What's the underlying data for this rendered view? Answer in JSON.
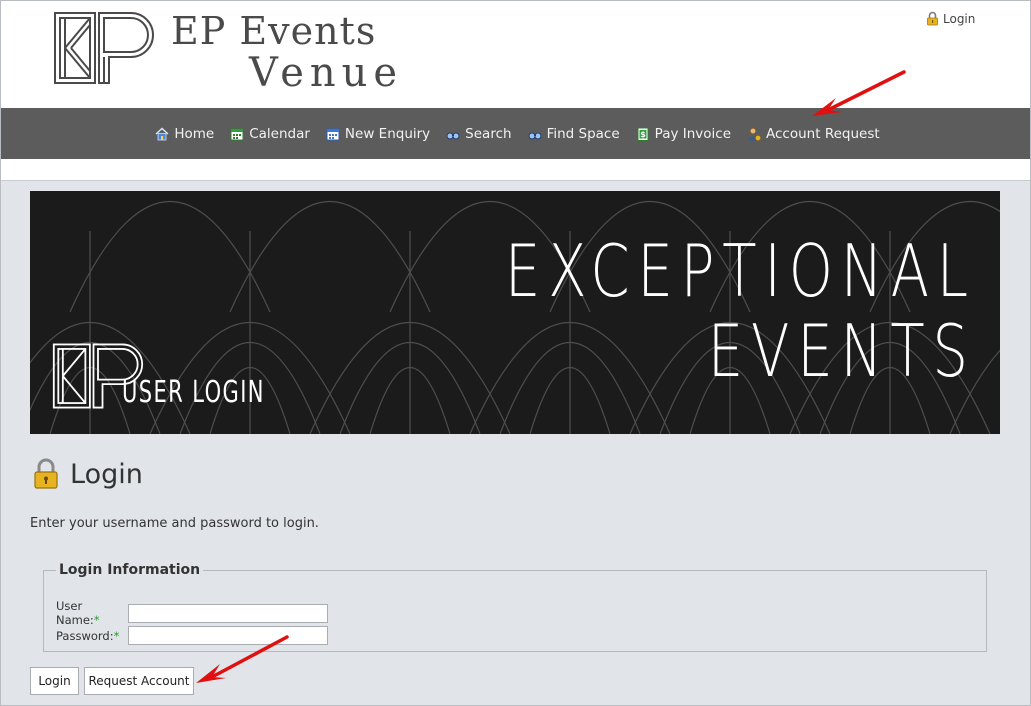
{
  "header": {
    "brand_line1": "EP Events",
    "brand_line2": "Venue",
    "top_login_label": "Login"
  },
  "nav": {
    "items": [
      {
        "label": "Home",
        "icon": "home-icon"
      },
      {
        "label": "Calendar",
        "icon": "calendar-icon"
      },
      {
        "label": "New Enquiry",
        "icon": "calendar-plus-icon"
      },
      {
        "label": "Search",
        "icon": "binoculars-icon"
      },
      {
        "label": "Find Space",
        "icon": "binoculars-icon"
      },
      {
        "label": "Pay Invoice",
        "icon": "dollar-document-icon"
      },
      {
        "label": "Account Request",
        "icon": "user-request-icon"
      }
    ]
  },
  "banner": {
    "title_line1": "EXCEPTIONAL",
    "title_line2": "EVENTS",
    "subtitle": "USER LOGIN"
  },
  "login": {
    "title": "Login",
    "intro": "Enter your username and password to login.",
    "legend": "Login Information",
    "username_label": "User Name:",
    "password_label": "Password:",
    "required_mark": "*",
    "username_value": "",
    "password_value": "",
    "login_button": "Login",
    "request_button": "Request Account"
  },
  "colors": {
    "nav_bg": "#5c5c5c",
    "page_bg": "#e1e4e8",
    "banner_bg": "#1b1b1b",
    "annotation_arrow": "#e01010"
  }
}
